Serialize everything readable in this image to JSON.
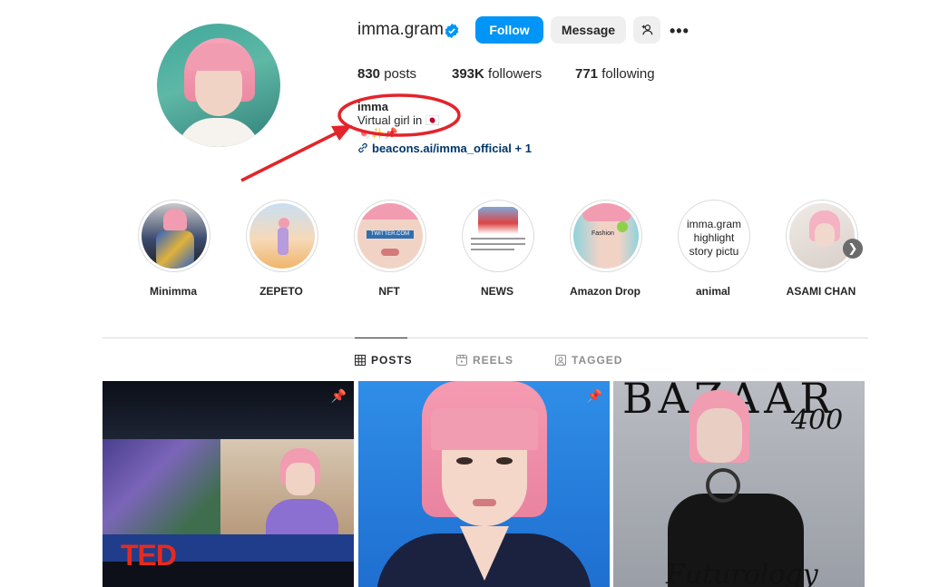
{
  "profile": {
    "username": "imma.gram",
    "follow_label": "Follow",
    "message_label": "Message",
    "more_label": "•••",
    "stats": {
      "posts_count": "830",
      "posts_label": "posts",
      "followers_count": "393K",
      "followers_label": "followers",
      "following_count": "771",
      "following_label": "following"
    },
    "name": "imma",
    "bio": "Virtual girl in 🇯🇵",
    "emoji_line": "🍬✨📌",
    "link_text": "beacons.ai/imma_official + 1"
  },
  "highlights": [
    {
      "label": "Minimma"
    },
    {
      "label": "ZEPETO"
    },
    {
      "label": "NFT",
      "overlay": "TWITTER.COM"
    },
    {
      "label": "NEWS"
    },
    {
      "label": "Amazon Drop",
      "overlay": "Fashion"
    },
    {
      "label": "animal",
      "overlay": "imma.gram highlight story pictu"
    },
    {
      "label": "ASAMI CHAN"
    }
  ],
  "tabs": [
    {
      "label": "POSTS",
      "active": true
    },
    {
      "label": "REELS",
      "active": false
    },
    {
      "label": "TAGGED",
      "active": false
    }
  ],
  "posts": [
    {
      "overlay": "TED",
      "pinned": true
    },
    {
      "pinned": true
    },
    {
      "overlay_top": "BAZAAR",
      "overlay_num": "400",
      "overlay_bottom": "Futurology",
      "pinned": false
    }
  ],
  "colors": {
    "accent": "#0095f6",
    "link": "#00376b",
    "annotation": "#e3242b",
    "verified": "#0095f6"
  }
}
